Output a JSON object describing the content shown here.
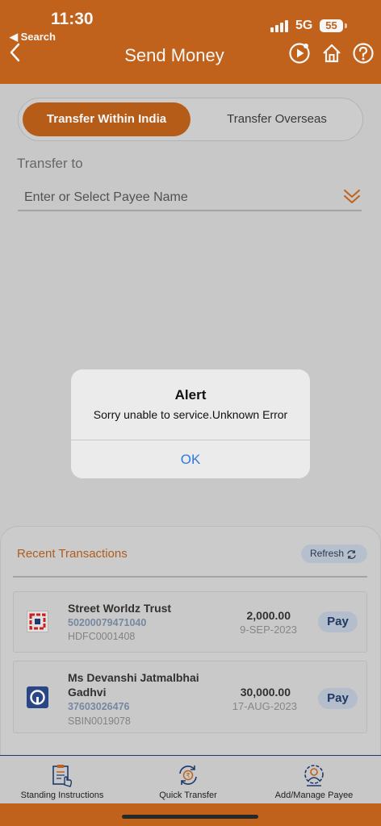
{
  "status_bar": {
    "time": "11:30",
    "back_label": "◀ Search",
    "network": "5G",
    "battery": "55"
  },
  "header": {
    "title": "Send Money",
    "back_icon": "chevron-left-icon",
    "actions": [
      "play-icon",
      "home-icon",
      "help-icon"
    ]
  },
  "tabs": {
    "active": "Transfer Within India",
    "inactive": "Transfer Overseas"
  },
  "transfer": {
    "label": "Transfer to",
    "payee_placeholder": "Enter or Select Payee Name"
  },
  "recent": {
    "title": "Recent Transactions",
    "refresh_label": "Refresh",
    "transactions": [
      {
        "name": "Street Worldz Trust",
        "account": "50200079471040",
        "ifsc": "HDFC0001408",
        "amount": "2,000.00",
        "date": "9-SEP-2023",
        "pay_label": "Pay",
        "logo": "hdfc-bank-logo"
      },
      {
        "name_line1": "Ms Devanshi Jatmalbhai",
        "name_line2": "Gadhvi",
        "account": "37603026476",
        "ifsc": "SBIN0019078",
        "amount": "30,000.00",
        "date": "17-AUG-2023",
        "pay_label": "Pay",
        "logo": "sbi-bank-logo"
      }
    ]
  },
  "bottom_tabs": [
    {
      "label": "Standing Instructions",
      "icon": "clipboard-hand-icon"
    },
    {
      "label": "Quick Transfer",
      "icon": "rupee-cycle-icon"
    },
    {
      "label": "Add/Manage Payee",
      "icon": "user-gear-icon"
    }
  ],
  "alert": {
    "title": "Alert",
    "message": "Sorry unable to service.Unknown Error",
    "ok_label": "OK"
  },
  "colors": {
    "brand_orange": "#c7661c",
    "active_tab": "#bb5f1a",
    "link_blue": "#2d7ad8",
    "navy": "#1e3b72"
  }
}
